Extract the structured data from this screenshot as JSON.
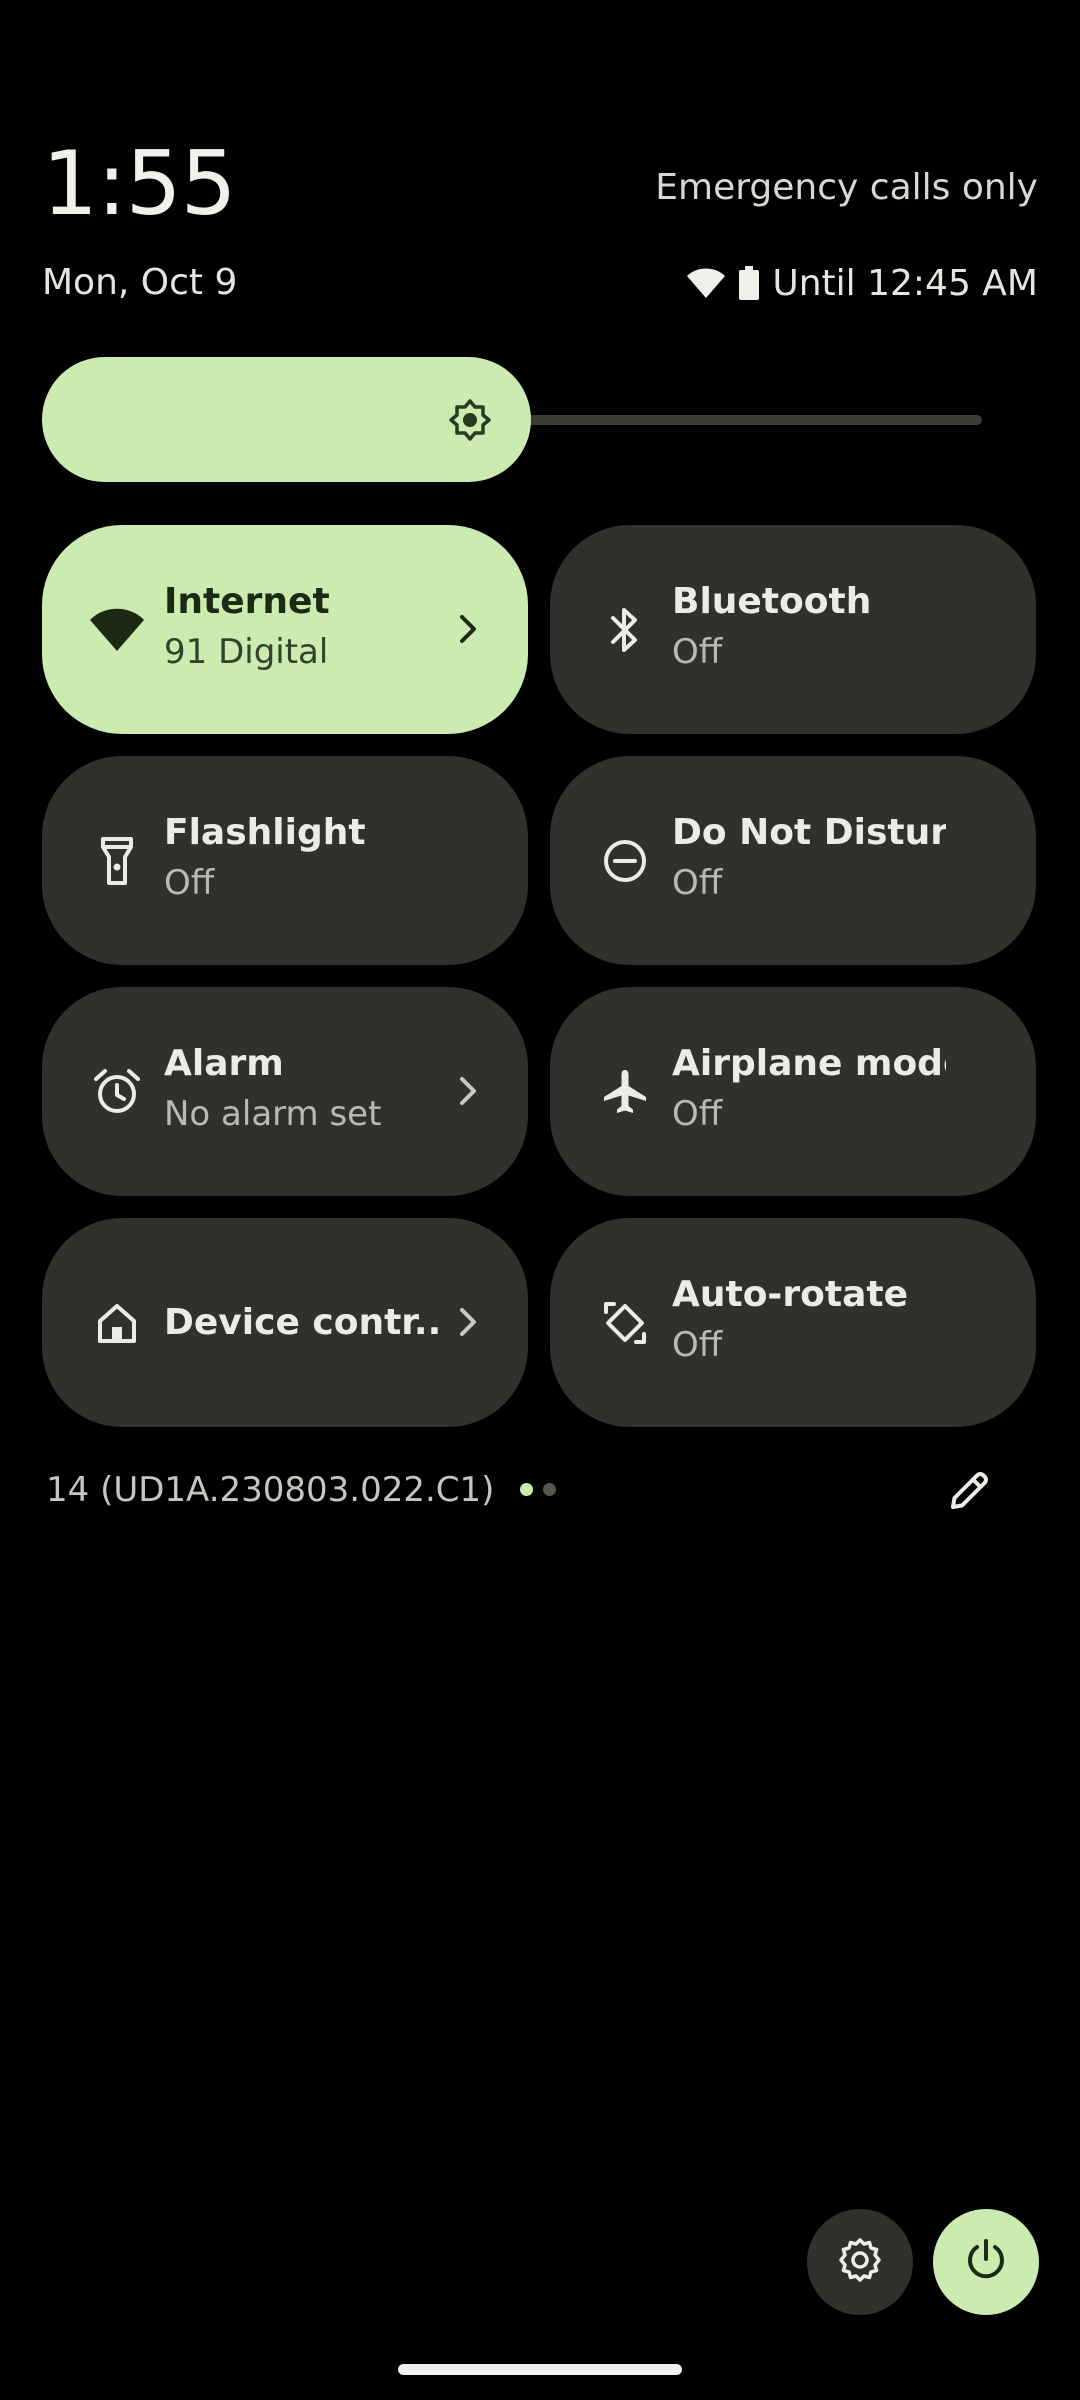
{
  "header": {
    "time": "1:55",
    "carrier": "Emergency calls only",
    "date": "Mon, Oct 9",
    "battery_text": "Until 12:45 AM"
  },
  "brightness": {
    "level": 0.52
  },
  "tiles": [
    {
      "label": "Internet",
      "sub": "91 Digital",
      "icon": "wifi-icon",
      "active": true,
      "chevron": true
    },
    {
      "label": "Bluetooth",
      "sub": "Off",
      "icon": "bluetooth-icon",
      "active": false,
      "chevron": false
    },
    {
      "label": "Flashlight",
      "sub": "Off",
      "icon": "flashlight-icon",
      "active": false,
      "chevron": false
    },
    {
      "label": "Do Not Disturb",
      "sub": "Off",
      "icon": "do-not-disturb-icon",
      "active": false,
      "chevron": false
    },
    {
      "label": "Alarm",
      "sub": "No alarm set",
      "icon": "alarm-icon",
      "active": false,
      "chevron": true
    },
    {
      "label": "Airplane mode",
      "sub": "Off",
      "icon": "airplane-icon",
      "active": false,
      "chevron": false
    },
    {
      "label": "Device contr..",
      "sub": "",
      "icon": "home-icon",
      "active": false,
      "chevron": true
    },
    {
      "label": "Auto-rotate",
      "sub": "Off",
      "icon": "auto-rotate-icon",
      "active": false,
      "chevron": false
    }
  ],
  "footer": {
    "build": "14 (UD1A.230803.022.C1)",
    "page_count": 2,
    "current_page": 1
  },
  "colors": {
    "accent": "#cbebb1",
    "tile_bg": "#30312d",
    "background": "#000000"
  }
}
